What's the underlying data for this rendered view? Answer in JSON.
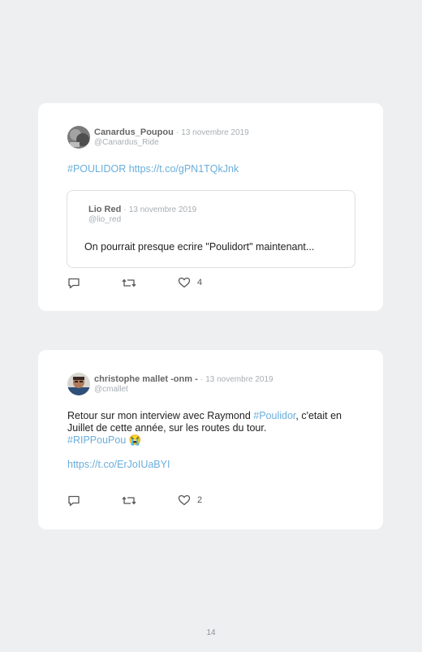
{
  "tweets": [
    {
      "author_name": "Canardus_Poupou",
      "date": "13 novembre 2019",
      "handle": "@Canardus_Ride",
      "text_hashtag": "#POULIDOR",
      "text_link": "https://t.co/gPN1TQkJnk",
      "quote": {
        "author_name": "Lio Red",
        "date": "13 novembre 2019",
        "handle": "@lio_red",
        "text": "On pourrait presque ecrire \"Poulidort\" maintenant..."
      },
      "likes": "4"
    },
    {
      "author_name": "christophe mallet -onm -",
      "date": "13 novembre 2019",
      "handle": "@cmallet",
      "text_part1": "Retour sur mon interview avec Raymond ",
      "text_hashtag1": "#Poulidor",
      "text_part2": ", c'etait en Juillet de cette année, sur les routes du tour.",
      "text_hashtag2": "#RIPPouPou",
      "text_emoji": "😭",
      "text_link": "https://t.co/ErJoIUaBYI",
      "likes": "2"
    }
  ],
  "separator": "·",
  "page_number": "14",
  "colors": {
    "link": "#6aaedb",
    "background": "#eeeff0",
    "card": "#ffffff"
  },
  "icons": [
    "reply-icon",
    "retweet-icon",
    "like-icon"
  ]
}
